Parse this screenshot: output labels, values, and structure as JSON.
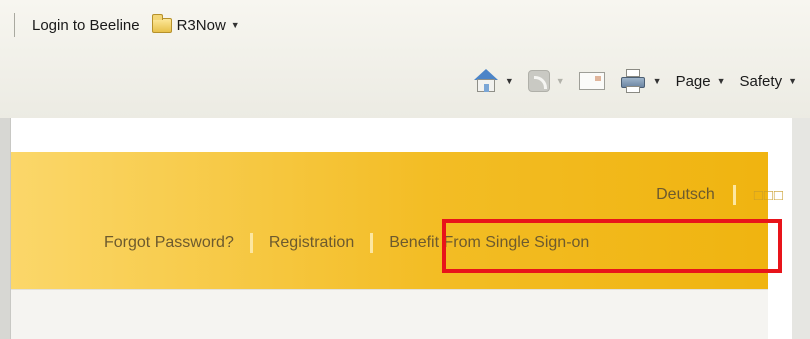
{
  "browser": {
    "favorites": [
      {
        "label": "Login to Beeline",
        "icon": "page-icon"
      },
      {
        "label": "R3Now",
        "icon": "folder-icon"
      }
    ],
    "toolbar": {
      "page_label": "Page",
      "safety_label": "Safety"
    }
  },
  "site": {
    "languages": [
      "Deutsch",
      "□□□"
    ],
    "nav": {
      "forgot_password": "Forgot Password?",
      "registration": "Registration",
      "sso": "Benefit From Single Sign-on"
    },
    "colors": {
      "banner_light": "#fbd76a",
      "banner_dark": "#f0b410",
      "link": "#6d5a2e",
      "highlight": "#e8141a"
    }
  }
}
